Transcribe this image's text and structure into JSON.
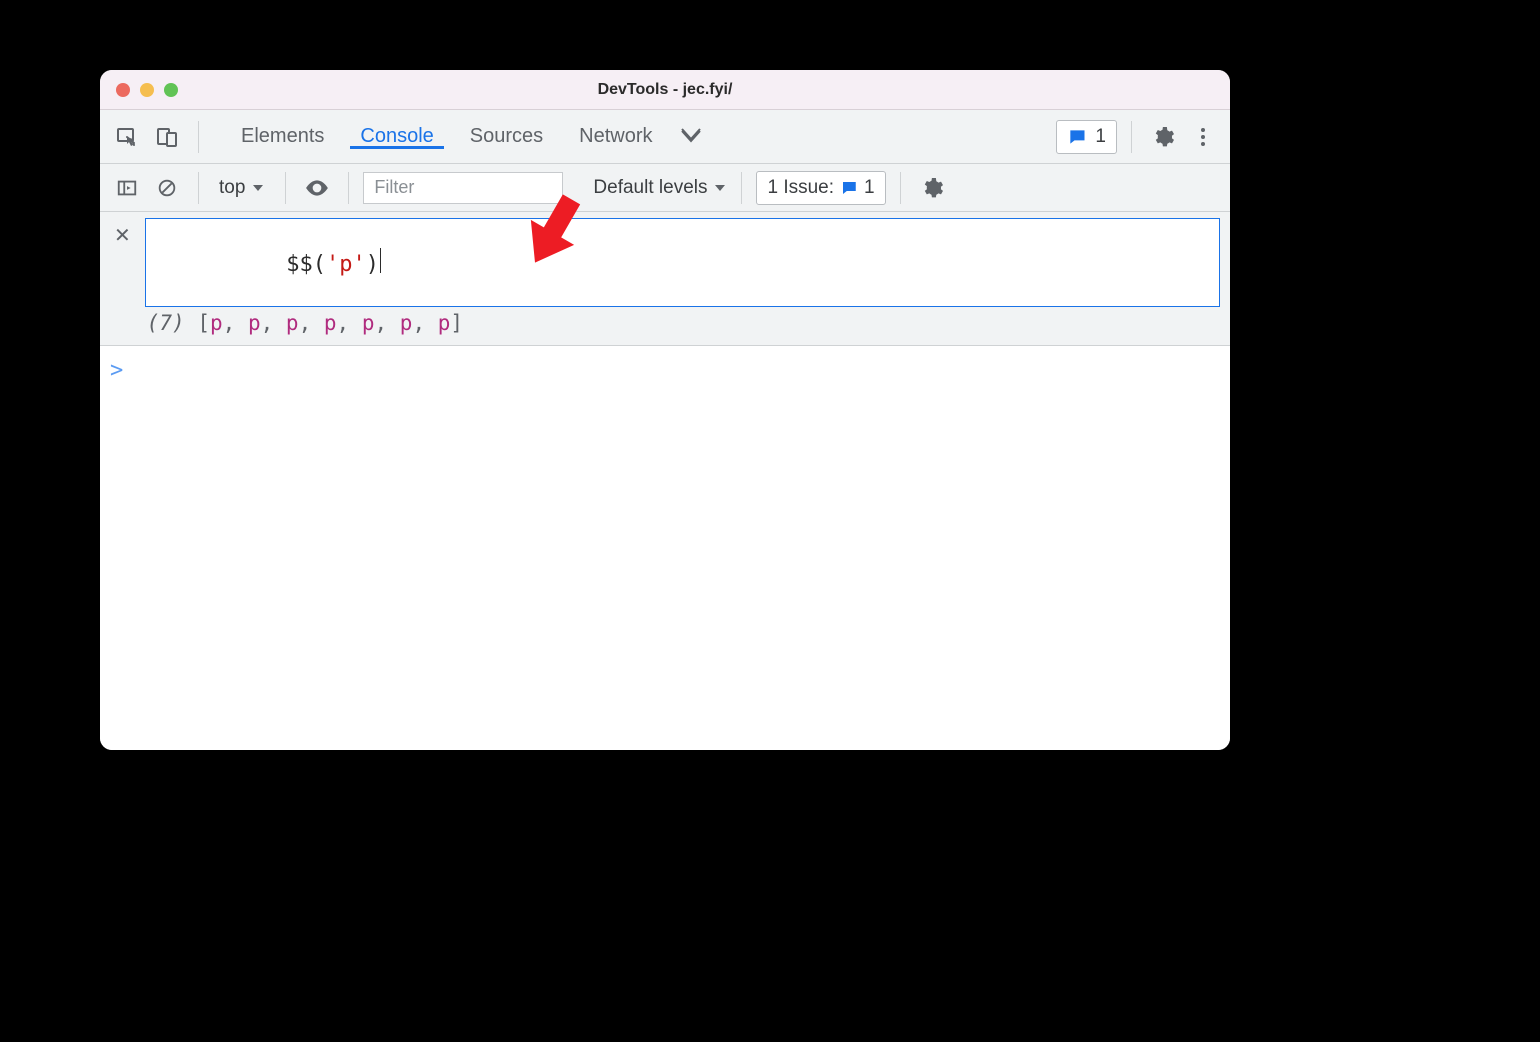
{
  "title": "DevTools - jec.fyi/",
  "tabs": {
    "elements": "Elements",
    "console": "Console",
    "sources": "Sources",
    "network": "Network"
  },
  "active_tab": "console",
  "messages_count": "1",
  "filterbar": {
    "context": "top",
    "filter_placeholder": "Filter",
    "levels_label": "Default levels",
    "issues_prefix": "1 Issue:",
    "issues_count": "1"
  },
  "live_expression": {
    "code_dollar": "$$",
    "code_open": "(",
    "code_string": "'p'",
    "code_close": ")",
    "result_count": "(7)",
    "result_elements": [
      "p",
      "p",
      "p",
      "p",
      "p",
      "p",
      "p"
    ]
  },
  "prompt_symbol": ">"
}
